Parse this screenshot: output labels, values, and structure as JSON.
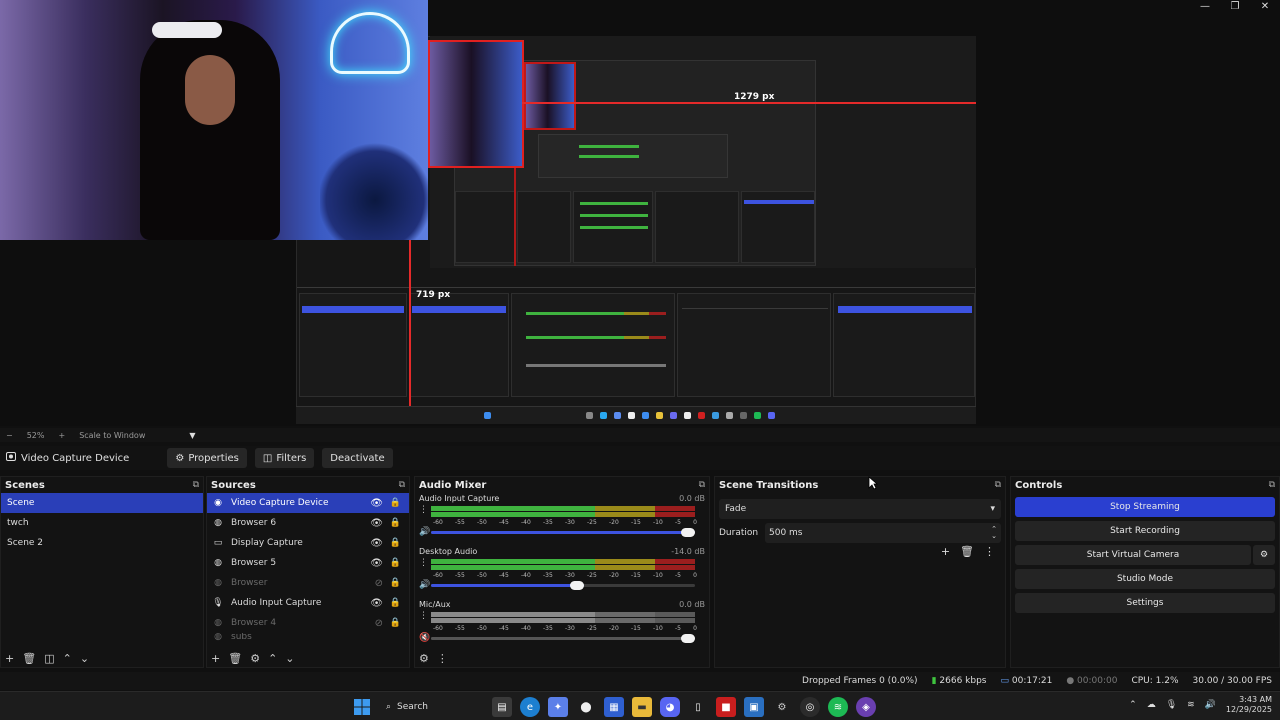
{
  "window_controls": [
    "—",
    "❐",
    "✕"
  ],
  "preview": {
    "measure_horizontal": "1279 px",
    "measure_vertical": "719 px"
  },
  "zoom_strip": {
    "minus": "−",
    "zoom_level": "52%",
    "plus": "+",
    "scale_mode": "Scale to Window",
    "caret": "▼"
  },
  "source_toolbar": {
    "source_name": "Video Capture Device",
    "properties_label": "Properties",
    "filters_label": "Filters",
    "deactivate_label": "Deactivate"
  },
  "scenes": {
    "title": "Scenes",
    "items": [
      "Scene",
      "twch",
      "Scene 2"
    ],
    "selected": 0
  },
  "sources": {
    "title": "Sources",
    "items": [
      {
        "label": "Video Capture Device",
        "icon": "camera-icon",
        "visible": true
      },
      {
        "label": "Browser 6",
        "icon": "globe-icon",
        "visible": true
      },
      {
        "label": "Display Capture",
        "icon": "monitor-icon",
        "visible": true
      },
      {
        "label": "Browser 5",
        "icon": "globe-icon",
        "visible": true
      },
      {
        "label": "Browser",
        "icon": "globe-icon",
        "visible": false
      },
      {
        "label": "Audio Input Capture",
        "icon": "microphone-icon",
        "visible": true
      },
      {
        "label": "Browser 4",
        "icon": "globe-icon",
        "visible": false
      },
      {
        "label": "subs",
        "icon": "globe-icon",
        "visible": false
      }
    ],
    "selected": 0
  },
  "audio_mixer": {
    "title": "Audio Mixer",
    "scale_ticks": [
      "-60",
      "-55",
      "-50",
      "-45",
      "-40",
      "-35",
      "-30",
      "-25",
      "-20",
      "-15",
      "-10",
      "-5",
      "0"
    ],
    "channels": [
      {
        "name": "Audio Input Capture",
        "db": "0.0 dB",
        "level": 0.72,
        "volume": 1.0,
        "muted": false
      },
      {
        "name": "Desktop Audio",
        "db": "-14.0 dB",
        "level": 0.64,
        "volume": 0.58,
        "muted": false
      },
      {
        "name": "Mic/Aux",
        "db": "0.0 dB",
        "level": 0.85,
        "volume": 1.0,
        "muted": true
      }
    ]
  },
  "scene_transitions": {
    "title": "Scene Transitions",
    "transition": "Fade",
    "duration_label": "Duration",
    "duration_value": "500 ms"
  },
  "controls": {
    "title": "Controls",
    "stop_streaming": "Stop Streaming",
    "start_recording": "Start Recording",
    "start_virtual_camera": "Start Virtual Camera",
    "studio_mode": "Studio Mode",
    "settings": "Settings"
  },
  "status_bar": {
    "dropped_frames": "Dropped Frames 0 (0.0%)",
    "bitrate": "2666 kbps",
    "stream_time": "00:17:21",
    "record_time": "00:00:00",
    "cpu": "CPU: 1.2%",
    "fps": "30.00 / 30.00 FPS"
  },
  "taskbar": {
    "search_label": "Search",
    "time": "3:43 AM",
    "date": "12/29/2025"
  },
  "colors": {
    "accent": "#2a3fd0",
    "selection": "#2a3fb8",
    "meter_green": "#3fb33f",
    "meter_yellow": "#9a8a1a",
    "meter_red": "#9b1e1e",
    "measure_red": "#e52a2a"
  }
}
